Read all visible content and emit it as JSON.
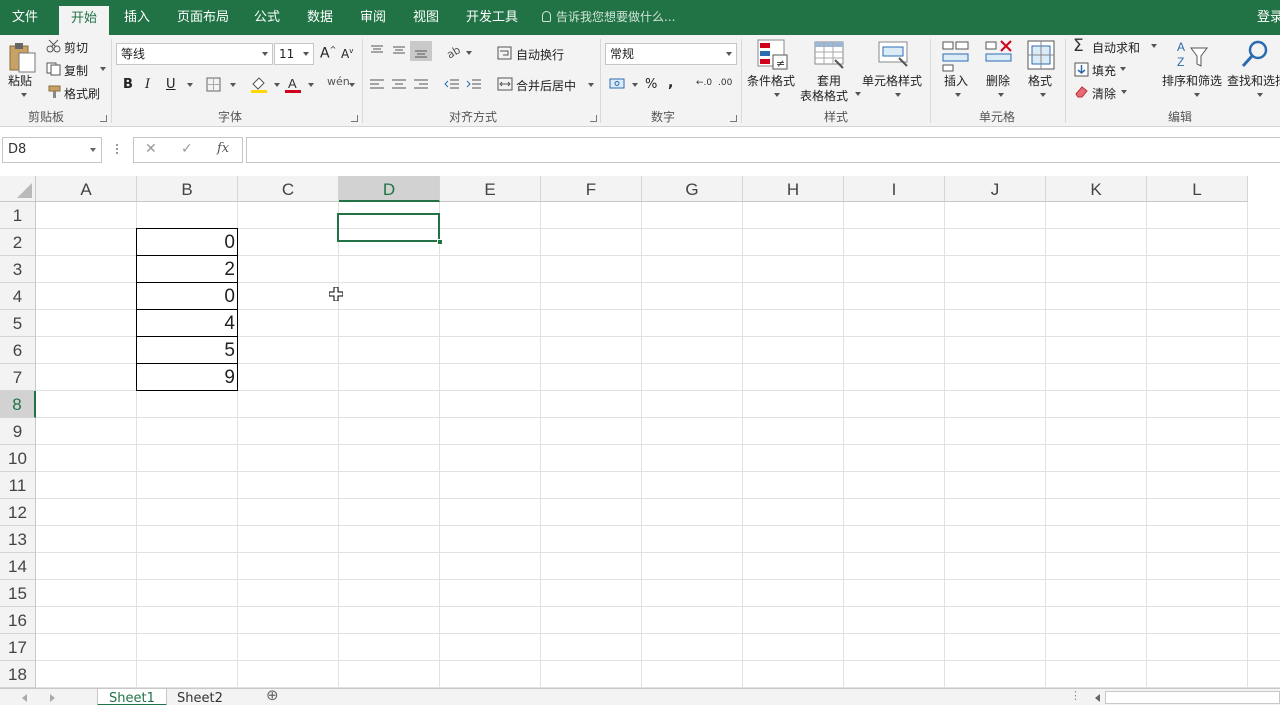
{
  "tabs": {
    "file": "文件",
    "home": "开始",
    "insert": "插入",
    "page_layout": "页面布局",
    "formulas": "公式",
    "data": "数据",
    "review": "审阅",
    "view": "视图",
    "developer": "开发工具",
    "tell_me": "告诉我您想要做什么...",
    "login": "登录"
  },
  "clipboard": {
    "paste": "粘贴",
    "cut": "剪切",
    "copy": "复制",
    "format_painter": "格式刷",
    "label": "剪贴板"
  },
  "font": {
    "name": "等线",
    "size": "11",
    "label": "字体"
  },
  "alignment": {
    "wrap_text": "自动换行",
    "merge_center": "合并后居中",
    "label": "对齐方式"
  },
  "number": {
    "format": "常规",
    "label": "数字"
  },
  "styles": {
    "conditional_formatting": "条件格式",
    "format_as_table_line1": "套用",
    "format_as_table_line2": "表格格式",
    "cell_styles": "单元格样式",
    "label": "样式"
  },
  "cells_group": {
    "insert": "插入",
    "delete": "删除",
    "format": "格式",
    "label": "单元格"
  },
  "editing": {
    "autosum": "自动求和",
    "fill": "填充",
    "clear": "清除",
    "sort_filter": "排序和筛选",
    "find_select": "查找和选择",
    "label": "编辑"
  },
  "formula_bar": {
    "name_box": "D8",
    "fx": "fx",
    "content": ""
  },
  "columns": [
    "A",
    "B",
    "C",
    "D",
    "E",
    "F",
    "G",
    "H",
    "I",
    "J",
    "K",
    "L"
  ],
  "rows": [
    "1",
    "2",
    "3",
    "4",
    "5",
    "6",
    "7",
    "8",
    "9",
    "10",
    "11",
    "12",
    "13",
    "14",
    "15",
    "16",
    "17",
    "18"
  ],
  "cells": {
    "B2": "0",
    "B3": "2",
    "B4": "0",
    "B5": "4",
    "B6": "5",
    "B7": "9"
  },
  "selected_cell": "D8",
  "sheets": [
    "Sheet1",
    "Sheet2"
  ],
  "active_sheet": "Sheet1",
  "colors": {
    "accent": "#217346",
    "ribbon_bg": "#f3f3f3",
    "font_color": "#d0021b",
    "highlight": "#ffd800"
  }
}
